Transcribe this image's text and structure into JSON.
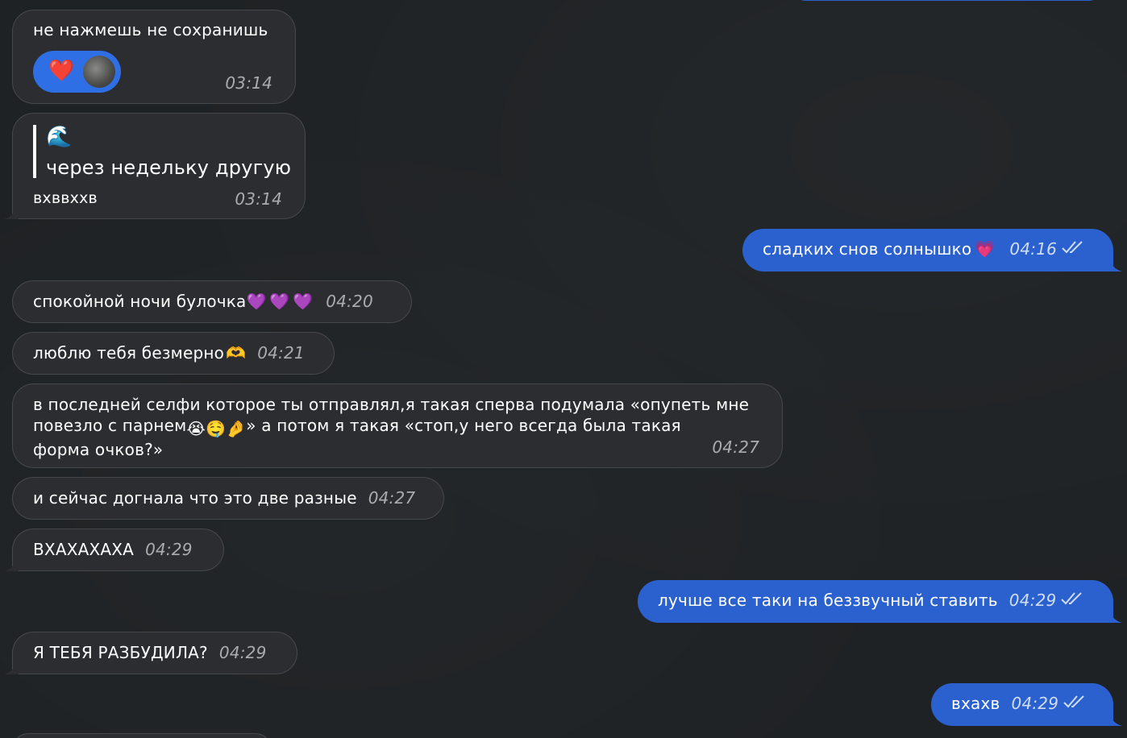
{
  "messages": [
    {
      "id": "m1",
      "side": "in",
      "text": "не нажмешь не сохранишь",
      "time": "03:14",
      "reaction": "❤️"
    },
    {
      "id": "m2",
      "side": "in",
      "reply_emoji": "🌊",
      "reply_text": "через недельку другую",
      "text": "вхввххв",
      "time": "03:14"
    },
    {
      "id": "m3",
      "side": "out",
      "text": "сладких снов солнышко",
      "emoji": "💗",
      "time": "04:16"
    },
    {
      "id": "m4",
      "side": "in",
      "text": "спокойной ночи булочка",
      "emoji": "💜💜💜",
      "time": "04:20"
    },
    {
      "id": "m5",
      "side": "in",
      "text": "люблю тебя безмерно",
      "emoji": "🫶",
      "time": "04:21"
    },
    {
      "id": "m6",
      "side": "in",
      "line1": "в последней селфи которое ты отправлял,я такая сперва подумала «опупеть мне",
      "line2a": "повезло с парнем",
      "line2_emoji": "😭🤤🤌",
      "line2b": "» а потом я такая «стоп,у него всегда была такая",
      "line3": "форма очков?»",
      "time": "04:27"
    },
    {
      "id": "m7",
      "side": "in",
      "text": "и сейчас догнала что это две разные",
      "time": "04:27"
    },
    {
      "id": "m8",
      "side": "in",
      "text": "ВХАХАХАХА",
      "time": "04:29"
    },
    {
      "id": "m9",
      "side": "out",
      "text": "лучше все таки на беззвучный ставить",
      "time": "04:29"
    },
    {
      "id": "m10",
      "side": "in",
      "text": "Я ТЕБЯ РАЗБУДИЛА?",
      "time": "04:29"
    },
    {
      "id": "m11",
      "side": "out",
      "text": "вхахв",
      "time": "04:29"
    }
  ]
}
